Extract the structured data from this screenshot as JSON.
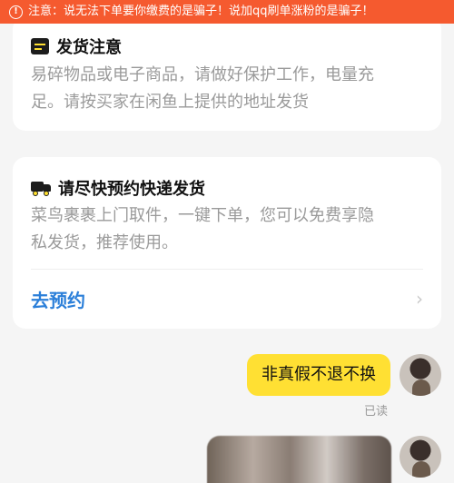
{
  "warning_bar": {
    "icon": "exclamation-circle-icon",
    "text": "注意：说无法下单要你缴费的是骗子！说加qq刷单涨粉的是骗子！"
  },
  "notice_card": {
    "icon": "notice-icon",
    "title": "发货注意",
    "line1": "易碎物品或电子商品，请做好保护工作，电量充",
    "line2": "足。请按买家在闲鱼上提供的地址发货"
  },
  "shipping_card": {
    "icon": "truck-icon",
    "title": "请尽快预约快递发货",
    "line1": "菜鸟裹裹上门取件，一键下单，您可以免费享隐",
    "line2": "私发货，推荐使用。",
    "action_label": "去预约",
    "action_icon": "chevron-right-icon"
  },
  "messages": [
    {
      "type": "text",
      "text": "非真假不退不换",
      "status": "已读"
    },
    {
      "type": "image"
    }
  ],
  "colors": {
    "warning_bg": "#f55a2f",
    "bubble_bg": "#ffe033",
    "link": "#2b7fd9",
    "page_bg": "#f5f5f5"
  }
}
